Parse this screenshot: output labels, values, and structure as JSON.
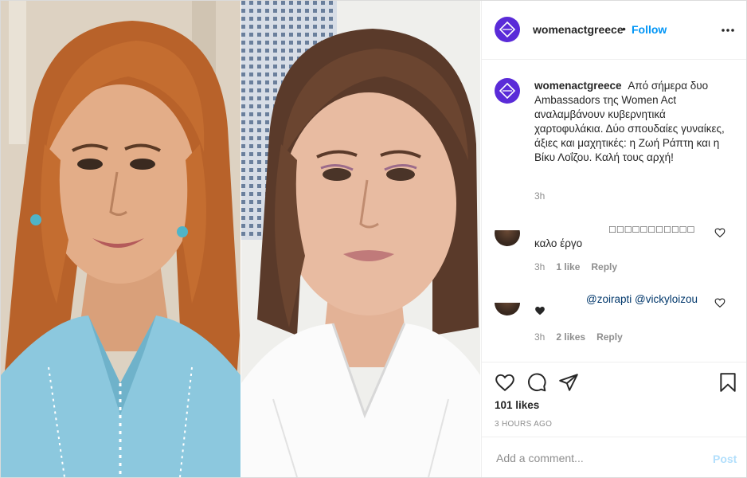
{
  "media": {
    "left_photo_icon": "portrait-photo",
    "right_photo_icon": "portrait-photo"
  },
  "header": {
    "username": "womenactgreece",
    "dot": "•",
    "follow_label": "Follow",
    "more_icon": "more-options-icon"
  },
  "caption": {
    "username": "womenactgreece",
    "text": "Από σήμερα δυο Ambassadors της Women Act αναλαμβάνουν κυβερνητικά χαρτοφυλάκια. Δύο σπουδαίες γυναίκες, άξιες και μαχητικές: η Ζωή Ράπτη και η Βίκυ Λοΐζου. Καλή τους αρχή!",
    "time": "3h"
  },
  "comments": [
    {
      "username": "□□□□□□□□□□□",
      "text": "καλο έργο",
      "time": "3h",
      "likes": "1 like",
      "reply": "Reply"
    },
    {
      "mentions": [
        "@zoirapti",
        "@vickyloizou"
      ],
      "text_icon": "heart-emoji",
      "time": "3h",
      "likes": "2 likes",
      "reply": "Reply"
    }
  ],
  "actions": {
    "likes": "101 likes",
    "time_ago": "3 HOURS AGO"
  },
  "add_comment": {
    "placeholder": "Add a comment...",
    "post_label": "Post"
  },
  "colors": {
    "accent": "#0095f6",
    "post_disabled": "#b2dffc",
    "avatar_brand": "#5a2bd8",
    "mention": "#00376b"
  }
}
